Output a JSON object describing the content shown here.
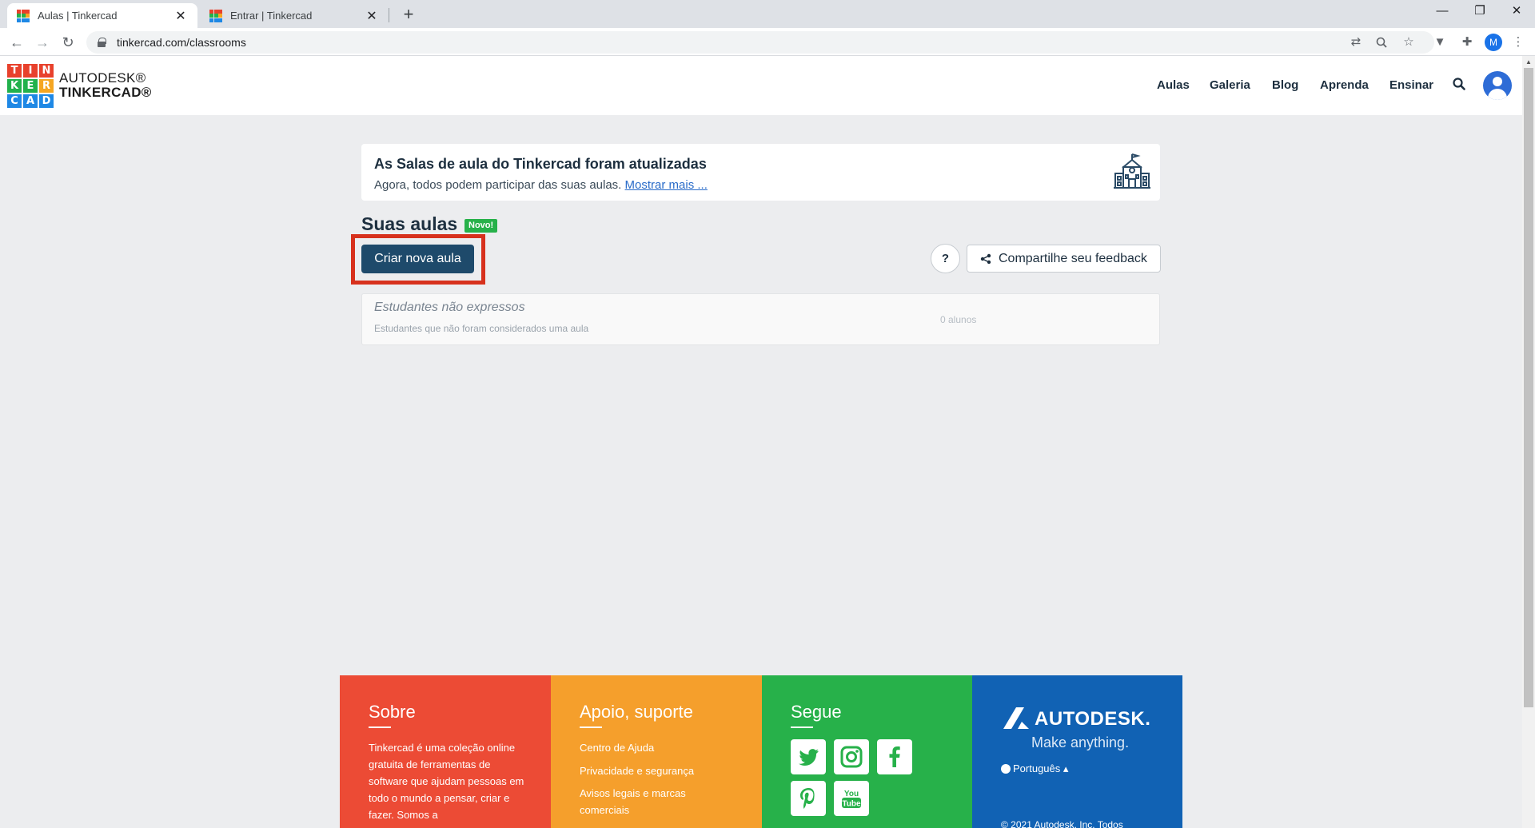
{
  "browser": {
    "tabs": [
      {
        "title": "Aulas | Tinkercad",
        "close": "✕"
      },
      {
        "title": "Entrar | Tinkercad",
        "close": "✕"
      }
    ],
    "new_tab": "+",
    "window_controls": {
      "minimize": "—",
      "restore": "❐",
      "close": "✕"
    },
    "url": "tinkercad.com/classrooms",
    "profile_initial": "M"
  },
  "header": {
    "logo_letters": [
      "T",
      "I",
      "N",
      "K",
      "E",
      "R",
      "C",
      "A",
      "D"
    ],
    "logo_colors": [
      "#e8412c",
      "#e8412c",
      "#e8412c",
      "#22b14c",
      "#22b14c",
      "#f5a623",
      "#1e88e5",
      "#1e88e5",
      "#1e88e5"
    ],
    "brand_line1": "AUTODESK®",
    "brand_line2": "TINKERCAD®",
    "nav": [
      "Aulas",
      "Galeria",
      "Blog",
      "Aprenda",
      "Ensinar"
    ]
  },
  "banner": {
    "title": "As Salas de aula do Tinkercad foram atualizadas",
    "subtitle": "Agora, todos podem participar das suas aulas.",
    "link": "Mostrar mais ..."
  },
  "classes": {
    "title": "Suas aulas",
    "badge": "Novo!",
    "create_button": "Criar nova aula",
    "help_button": "?",
    "feedback_button": "Compartilhe seu feedback",
    "unassigned": {
      "title": "Estudantes não expressos",
      "subtitle": "Estudantes que não foram considerados uma aula",
      "count": "0 alunos"
    }
  },
  "footer": {
    "about": {
      "title": "Sobre",
      "text": "Tinkercad é uma coleção online gratuita de ferramentas de software que ajudam pessoas em todo o mundo a pensar, criar e fazer. Somos a"
    },
    "support": {
      "title": "Apoio, suporte",
      "links": [
        "Centro de Ajuda",
        "Privacidade e segurança",
        "Avisos legais e marcas comerciais"
      ]
    },
    "follow": {
      "title": "Segue",
      "networks": [
        "twitter-icon",
        "instagram-icon",
        "facebook-icon",
        "pinterest-icon",
        "youtube-icon"
      ],
      "youtube_text": "You Tube"
    },
    "autodesk": {
      "wordmark": "AUTODESK.",
      "tagline": "Make anything.",
      "language": "Português ▴",
      "copyright": "© 2021 Autodesk, Inc. Todos"
    }
  },
  "colors": {
    "primary_button": "#1e4a6b",
    "highlight": "#d7311d",
    "badge": "#27b14a",
    "footer_red": "#ec4b35",
    "footer_orange": "#f59f2c",
    "footer_green": "#27b14a",
    "footer_blue": "#1162b4"
  }
}
